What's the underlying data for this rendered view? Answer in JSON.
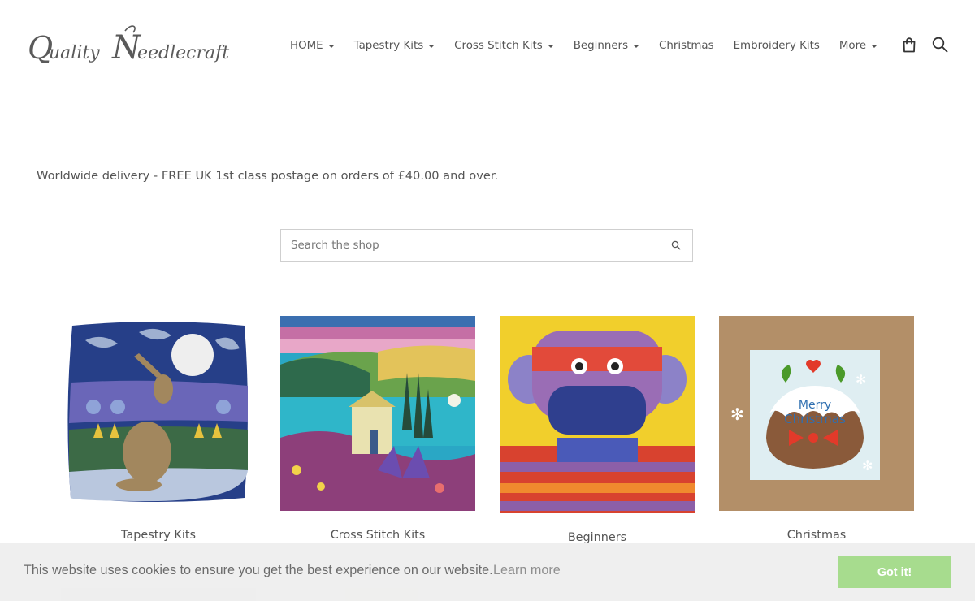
{
  "brand": {
    "logo_text": "Quality Needlecraft"
  },
  "nav": {
    "items": [
      {
        "label": "HOME",
        "dropdown": true
      },
      {
        "label": "Tapestry Kits",
        "dropdown": true
      },
      {
        "label": "Cross Stitch Kits",
        "dropdown": true
      },
      {
        "label": "Beginners",
        "dropdown": true
      },
      {
        "label": "Christmas",
        "dropdown": false
      },
      {
        "label": "Embroidery Kits",
        "dropdown": false
      },
      {
        "label": "More",
        "dropdown": true
      }
    ],
    "icons": [
      "shopping-bag-icon",
      "search-icon"
    ]
  },
  "notice": {
    "text": "Worldwide delivery - FREE UK 1st class postage on orders of £40.00 and over."
  },
  "shop_search": {
    "placeholder": "Search the shop",
    "icon": "search-icon"
  },
  "categories": [
    {
      "label": "Tapestry Kits",
      "image": "hare-moon-tapestry-cushion"
    },
    {
      "label": "Cross Stitch Kits",
      "image": "coastal-cottage-landscape-cross-stitch"
    },
    {
      "label": "Beginners",
      "image": "sock-monkey-tapestry"
    },
    {
      "label": "Christmas",
      "image": "christmas-pudding-card"
    }
  ],
  "cookie_banner": {
    "message": "This website uses cookies to ensure you get the best experience on our website.",
    "learn_more": "Learn more",
    "accept": "Got it!"
  },
  "colors": {
    "text": "#555555",
    "cookie_bg": "#eeeeee",
    "cookie_button": "#a7dc8e"
  }
}
